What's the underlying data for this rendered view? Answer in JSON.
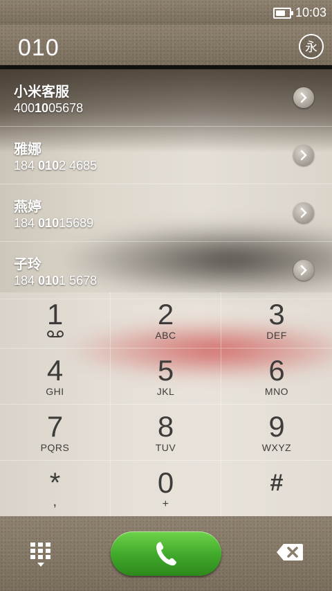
{
  "status_bar": {
    "time": "10:03",
    "battery_level": 0.8
  },
  "header": {
    "dialed_number": "010",
    "avatar_glyph": "永"
  },
  "contacts": [
    {
      "name": "小米客服",
      "number_pre": "400",
      "number_match": "10",
      "number_post": "05678"
    },
    {
      "name": "雅娜",
      "number_pre": "184 ",
      "number_match": "010",
      "number_post": "2 4685"
    },
    {
      "name": "燕婷",
      "number_pre": "184 ",
      "number_match": "010",
      "number_post": "15689"
    },
    {
      "name": "子玲",
      "number_pre": "184 ",
      "number_match": "010",
      "number_post": "1 5678"
    }
  ],
  "keypad": {
    "keys": [
      {
        "digit": "1",
        "letters": ""
      },
      {
        "digit": "2",
        "letters": "ABC"
      },
      {
        "digit": "3",
        "letters": "DEF"
      },
      {
        "digit": "4",
        "letters": "GHI"
      },
      {
        "digit": "5",
        "letters": "JKL"
      },
      {
        "digit": "6",
        "letters": "MNO"
      },
      {
        "digit": "7",
        "letters": "PQRS"
      },
      {
        "digit": "8",
        "letters": "TUV"
      },
      {
        "digit": "9",
        "letters": "WXYZ"
      },
      {
        "digit": "*",
        "letters": ","
      },
      {
        "digit": "0",
        "letters": "+"
      },
      {
        "digit": "#",
        "letters": ""
      }
    ],
    "voicemail_icon": "voicemail-icon"
  },
  "bottom_bar": {
    "keypad_toggle_icon": "keypad-grid-icon",
    "call_icon": "phone-handset-icon",
    "backspace_icon": "backspace-icon",
    "call_color": "#3fa72a"
  }
}
